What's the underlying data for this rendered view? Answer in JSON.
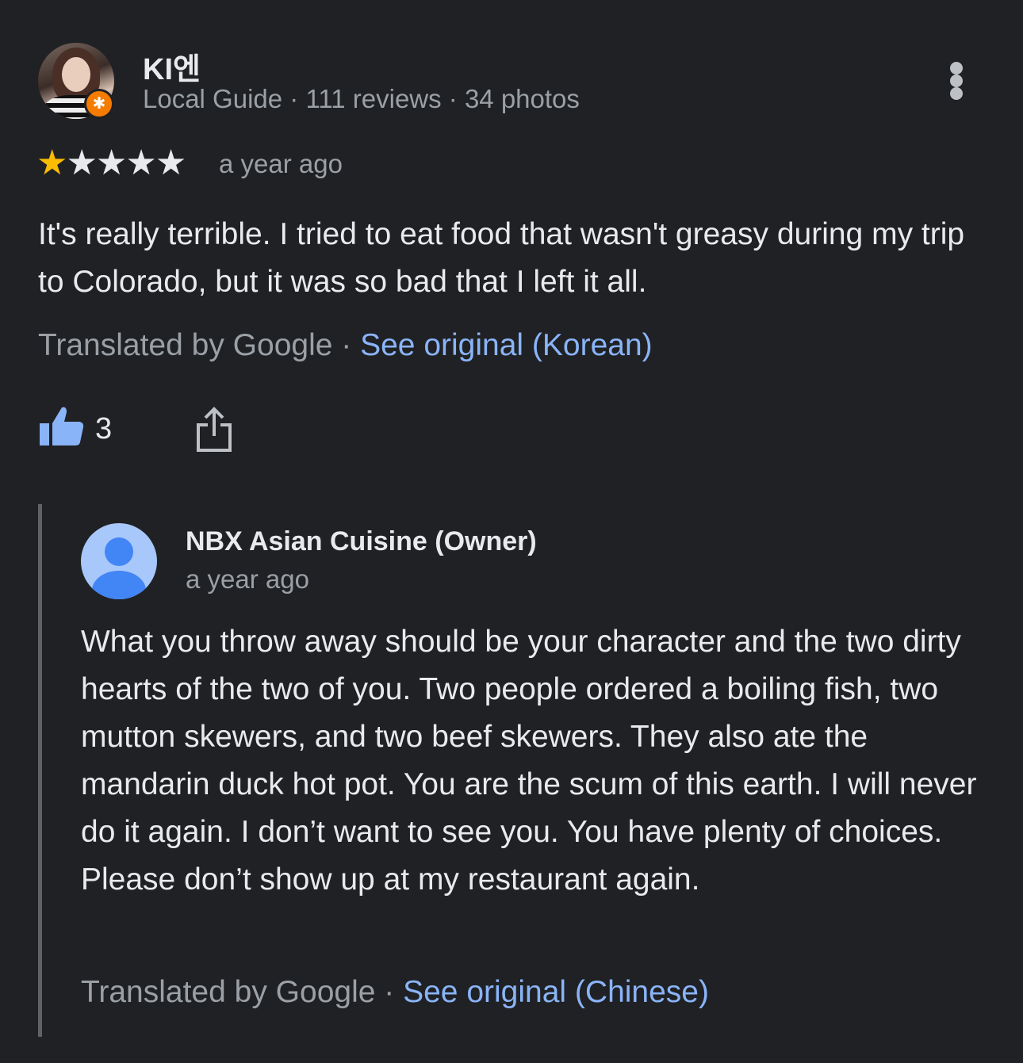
{
  "review": {
    "reviewer": {
      "name": "KI엔",
      "meta": "Local Guide · 111 reviews · 34 photos",
      "badge_icon": "star-icon"
    },
    "rating": {
      "filled": 1,
      "total": 5,
      "star_on_color": "#fbbc04"
    },
    "time": "a year ago",
    "text": "It's really terrible. I tried to eat food that wasn't greasy during my trip to Colorado, but it was so bad that I left it all.",
    "translation": {
      "label": "Translated by Google",
      "separator": " · ",
      "link": "See original (Korean)"
    },
    "likes": "3"
  },
  "owner_response": {
    "name": "NBX Asian Cuisine (Owner)",
    "time": "a year ago",
    "text": "What you throw away should be your character and the two dirty hearts of the two of you. Two people ordered a boiling fish, two mutton skewers, and two beef skewers. They also ate the mandarin duck hot pot. You are the scum of this earth. I will never do it again. I don’t want to see you. You have plenty of choices. Please don’t show up at my restaurant again.",
    "translation": {
      "label": "Translated by Google",
      "separator": " · ",
      "link": "See original (Chinese)"
    }
  },
  "colors": {
    "background": "#202124",
    "link": "#8ab4f8",
    "accent": "#8ab4f8"
  }
}
